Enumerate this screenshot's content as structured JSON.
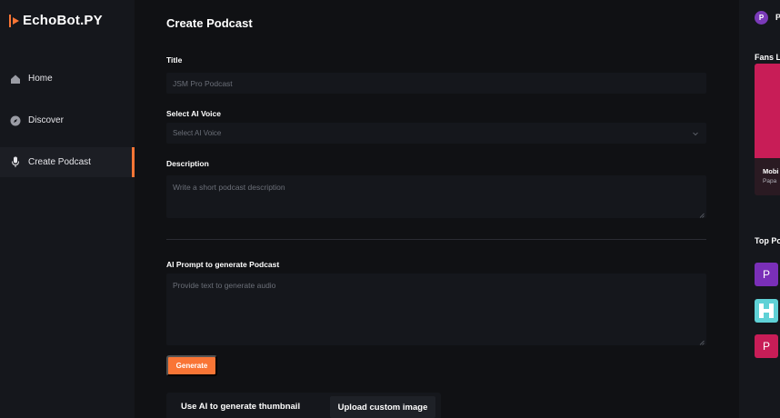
{
  "app": {
    "name": "EchoBot.PY",
    "brand_color": "#f97535"
  },
  "sidebar": {
    "items": [
      {
        "label": "Home",
        "icon": "home-icon"
      },
      {
        "label": "Discover",
        "icon": "compass-icon"
      },
      {
        "label": "Create Podcast",
        "icon": "microphone-icon",
        "active": true
      }
    ]
  },
  "main": {
    "title": "Create Podcast",
    "title_field": {
      "label": "Title",
      "placeholder": "JSM Pro Podcast"
    },
    "voice_field": {
      "label": "Select AI Voice",
      "placeholder": "Select AI Voice"
    },
    "description_field": {
      "label": "Description",
      "placeholder": "Write a short podcast description"
    },
    "prompt_field": {
      "label": "AI Prompt to generate Podcast",
      "placeholder": "Provide text to generate audio"
    },
    "generate_label": "Generate",
    "thumbnail": {
      "ai_label": "Use AI to generate thumbnail",
      "upload_label": "Upload custom image"
    }
  },
  "right": {
    "user_initial": "P",
    "user_name_visible": "P",
    "fans_title": "Fans L",
    "fan_card": {
      "title": "Mobi",
      "subtitle": "Papa"
    },
    "top_title": "Top Po",
    "top_podcasts": [
      {
        "initial": "P",
        "color": "#7a2fb8"
      },
      {
        "initial": "",
        "color": "#5fd1d6"
      },
      {
        "initial": "P",
        "color": "#c81d57"
      }
    ]
  }
}
